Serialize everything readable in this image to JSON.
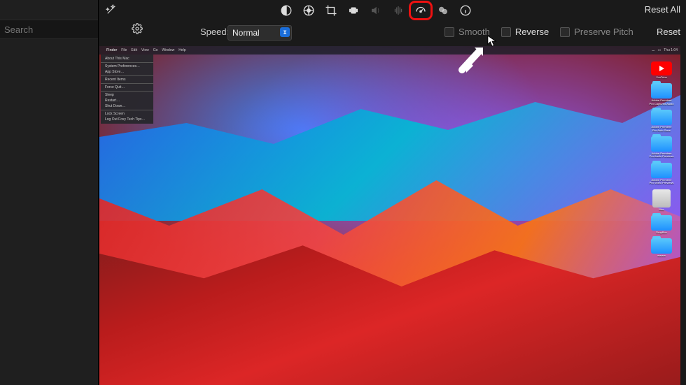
{
  "header": {
    "reset_all": "Reset All",
    "reset": "Reset"
  },
  "sidebar": {
    "search_placeholder": "Search"
  },
  "speed": {
    "label": "Speed:",
    "value": "Normal"
  },
  "options": {
    "smooth": "Smooth",
    "reverse": "Reverse",
    "preserve_pitch": "Preserve Pitch"
  },
  "mac_menubar": {
    "app": "Finder",
    "items": [
      "File",
      "Edit",
      "View",
      "Go",
      "Window",
      "Help"
    ],
    "clock": "Thu 1:04"
  },
  "apple_menu": {
    "items": [
      "About This Mac",
      "",
      "System Preferences…",
      "App Store…",
      "",
      "Recent Items",
      "",
      "Force Quit…",
      "",
      "Sleep",
      "Restart…",
      "Shut Down…",
      "",
      "Lock Screen",
      "Log Out Foxy Tech Tips…"
    ]
  },
  "desktop_icons": [
    {
      "type": "yt",
      "label": "YouTube"
    },
    {
      "type": "folder",
      "label": "Adobe Premiere Pro Captured Audio"
    },
    {
      "type": "folder",
      "label": "Adobe Premiere Pro Auto-Save"
    },
    {
      "type": "folder",
      "label": "Adobe Premiere Pro Audio Previews"
    },
    {
      "type": "folder",
      "label": "Adobe Premiere Pro Video Previews"
    },
    {
      "type": "hdd",
      "label": "Mac"
    },
    {
      "type": "folder",
      "label": "DropBox"
    },
    {
      "type": "folder",
      "label": "wwww"
    }
  ]
}
